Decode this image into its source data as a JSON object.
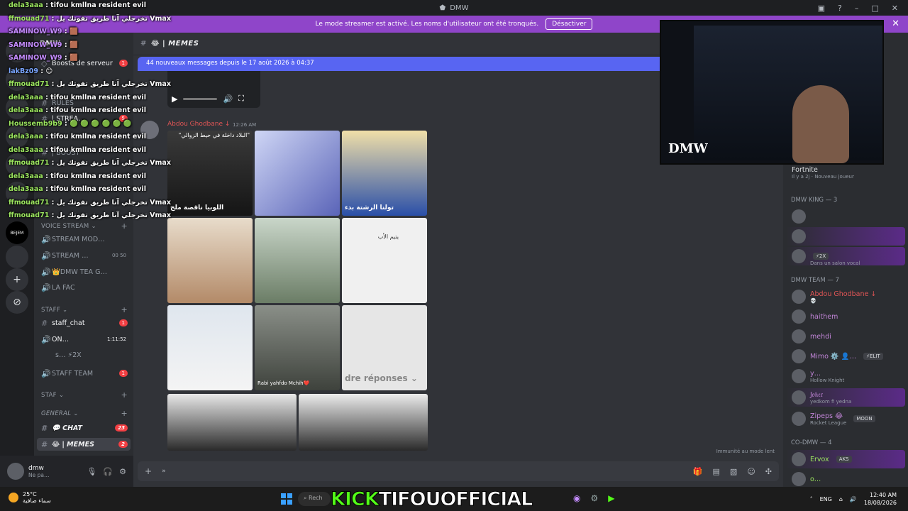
{
  "window": {
    "title": "DMW"
  },
  "banner": {
    "text": "Le mode streamer est activé. Les noms d'utilisateur ont été tronqués.",
    "button": "Désactiver"
  },
  "sidebar": {
    "server_name": "DMW",
    "channels_top": [
      {
        "label": "Boosts de serveur",
        "badge": "1"
      },
      {
        "label": "RULES",
        "badge": ""
      },
      {
        "label": "| STREA…",
        "badge": "5"
      },
      {
        "label": "| BOOST",
        "badge": ""
      }
    ],
    "voice_category": "VOICE STREAM",
    "voice_channels": [
      {
        "label": "STREAM MOD…",
        "extra": ""
      },
      {
        "label": "STREAM …",
        "extra": "00 50"
      },
      {
        "label": "👑DMW TEA G…",
        "extra": ""
      },
      {
        "label": "LA FAC",
        "extra": ""
      }
    ],
    "staff_category": "STAFF",
    "staff_channels": [
      {
        "label": "staff_chat",
        "badge": "1"
      },
      {
        "label": "ON…",
        "badge": "1:11:52"
      },
      {
        "label": "s… ⚡2X",
        "badge": ""
      },
      {
        "label": "STAFF TEAM",
        "badge": "1"
      }
    ],
    "staf_category": "STAF",
    "general_category": "GENERAL",
    "general_channels": [
      {
        "label": "💬 CHAT",
        "badge": "23"
      },
      {
        "label": "😂 | MEMES",
        "badge": "2"
      }
    ]
  },
  "user_panel": {
    "name": "dmw",
    "status": "Ne pa…"
  },
  "main": {
    "channel_title": "😂 | MEMES",
    "new_messages": "44 nouveaux messages depuis le 17 août 2026 à 04:37",
    "message": {
      "author": "Abdou Ghodbane ↓",
      "time": "12:26 AM"
    },
    "captions": {
      "img1_top": "\"البلاد داخلة في حيط الزوالي\"",
      "img1_bottom": "اللوبيا ناقصة ملح",
      "img3_bottom": "تولنا الرشتة بدء",
      "img6_top": "يتيم الأب",
      "img8_bottom": "Rabi yahfdo Mchih❤️",
      "img9_text": "dre réponses ⌄"
    },
    "slowmode": "Immunité au mode lent"
  },
  "members": {
    "top_item": {
      "name": "Fortnite",
      "sub": "Il y a 2j · Nouveau joueur"
    },
    "cat_king": "DMW KING — 3",
    "king": [
      {
        "name": "",
        "sub": "",
        "tag": ""
      },
      {
        "name": "",
        "sub": "",
        "tag": ""
      },
      {
        "name": "",
        "sub": "Dans un salon vocal",
        "tag": "⚡2X"
      }
    ],
    "cat_team": "DMW TEAM — 7",
    "team": [
      {
        "name": "Abdou Ghodbane ↓",
        "sub": "💀",
        "tag": "",
        "color": "#e05555"
      },
      {
        "name": "haithem",
        "sub": "",
        "tag": "",
        "color": "#c084d6"
      },
      {
        "name": "mehdi",
        "sub": "",
        "tag": "",
        "color": "#c084d6"
      },
      {
        "name": "Mimo ⚙️ 👤…",
        "sub": "",
        "tag": "⚡ELIT",
        "color": "#c084d6"
      },
      {
        "name": "y…",
        "sub": "Hollow Knight",
        "tag": "",
        "color": "#c084d6"
      },
      {
        "name": "J𝔬𝔨𝔢𝔯",
        "sub": "yedkom fi yedna",
        "tag": "",
        "color": "#c084d6"
      },
      {
        "name": "Zipeps 😂",
        "sub": "Rocket League",
        "tag": "MOON",
        "color": "#c084d6"
      }
    ],
    "cat_co": "CO-DMW — 4",
    "co": [
      {
        "name": "Ervox",
        "sub": "",
        "tag": "AKS",
        "color": "#9ce65f"
      },
      {
        "name": "o…",
        "sub": "",
        "tag": "",
        "color": "#9ce65f"
      }
    ]
  },
  "webcam": {
    "logo": "DMW"
  },
  "overlay": {
    "lines": [
      {
        "user": "dela3aaa",
        "text": ": tifou kmllna resident evil",
        "cls": ""
      },
      {
        "user": "ffmouad71",
        "text": ": تخرجلي آنا طريق تفوتك يل Vmax",
        "cls": ""
      },
      {
        "user": "SAMINOW_W9",
        "text": ": 🟫",
        "cls": "p"
      },
      {
        "user": "SAMINOW_W9",
        "text": ": 🟫",
        "cls": "p"
      },
      {
        "user": "SAMINOW_W9",
        "text": ": 🟫",
        "cls": "p"
      },
      {
        "user": "lakBz09",
        "text": ": 😊",
        "cls": "b"
      },
      {
        "user": "ffmouad71",
        "text": ": تخرجلي آنا طريق تفوتك يل Vmax",
        "cls": ""
      },
      {
        "user": "dela3aaa",
        "text": ": tifou kmllna resident evil",
        "cls": ""
      },
      {
        "user": "dela3aaa",
        "text": ": tifou kmllna resident evil",
        "cls": ""
      },
      {
        "user": "Houssemb9b9",
        "text": ": 🟢 🟢 🟢 🟢 🟢 🟢",
        "cls": ""
      },
      {
        "user": "dela3aaa",
        "text": ": tifou kmllna resident evil",
        "cls": ""
      },
      {
        "user": "dela3aaa",
        "text": ": tifou kmllna resident evil",
        "cls": ""
      },
      {
        "user": "ffmouad71",
        "text": ": تخرجلي آنا طريق تفوتك يل Vmax",
        "cls": ""
      },
      {
        "user": "dela3aaa",
        "text": ": tifou kmllna resident evil",
        "cls": ""
      },
      {
        "user": "dela3aaa",
        "text": ": tifou kmllna resident evil",
        "cls": ""
      },
      {
        "user": "ffmouad71",
        "text": ": تخرجلي آنا طريق تفوتك يل Vmax",
        "cls": ""
      },
      {
        "user": "ffmouad71",
        "text": ": تخرجلي آنا طريق تفوتك يل Vmax",
        "cls": ""
      }
    ]
  },
  "taskbar": {
    "weather_temp": "25°C",
    "weather_desc": "سماء صافية",
    "search": "Rech",
    "kick_prefix": "KICK",
    "kick_name": "TIFOUOFFICIAL",
    "lang": "ENG",
    "time": "12:40 AM",
    "date": "18/08/2026"
  }
}
